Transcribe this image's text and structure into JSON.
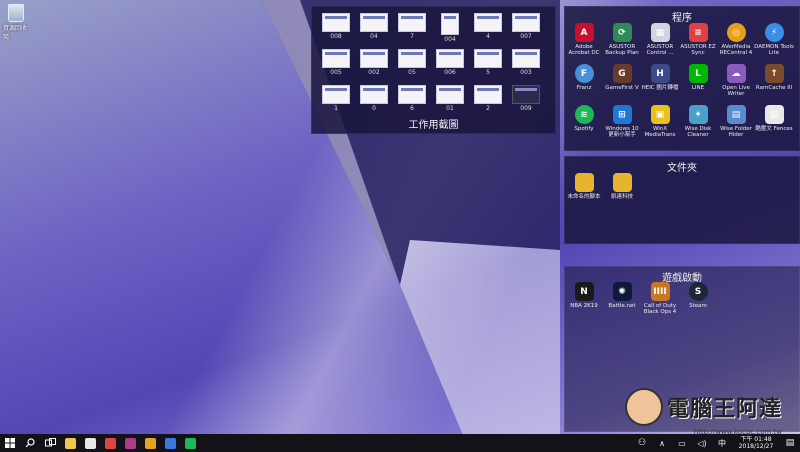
{
  "desktop": {
    "recycle_bin_label": "資源回收筒"
  },
  "fence_screenshots": {
    "title": "工作用截圖",
    "items": [
      "008",
      "04",
      "7",
      "004",
      "4",
      "007",
      "005",
      "002",
      "05",
      "006",
      "5",
      "003",
      "1",
      "0",
      "6",
      "01",
      "2",
      "009"
    ]
  },
  "fence_programs": {
    "title": "程序",
    "items": [
      {
        "label": "Adobe Acrobat DC",
        "icon": "acrobat-icon",
        "color": "#c8102e",
        "glyph": "A"
      },
      {
        "label": "ASUSTOR Backup Plan",
        "icon": "backup-icon",
        "color": "#2e8b57",
        "glyph": "⟳"
      },
      {
        "label": "ASUSTOR Control ...",
        "icon": "control-icon",
        "color": "#d0d4dc",
        "glyph": "▦"
      },
      {
        "label": "ASUSTOR EZ Sync",
        "icon": "ezsync-icon",
        "color": "#e04040",
        "glyph": "≡"
      },
      {
        "label": "AVerMedia RECentral 4",
        "icon": "recentral-icon",
        "color": "#e6a11a",
        "glyph": "◎"
      },
      {
        "label": "DAEMON Tools Lite",
        "icon": "daemon-icon",
        "color": "#3a8ee8",
        "glyph": "⚡"
      },
      {
        "label": "Franz",
        "icon": "franz-icon",
        "color": "#4a90d9",
        "glyph": "F"
      },
      {
        "label": "GameFirst V",
        "icon": "gamefirst-icon",
        "color": "#6a3a2a",
        "glyph": "G"
      },
      {
        "label": "HEIC 圖片轉檔",
        "icon": "heic-icon",
        "color": "#3a4a8a",
        "glyph": "H"
      },
      {
        "label": "LINE",
        "icon": "line-icon",
        "color": "#00b900",
        "glyph": "L"
      },
      {
        "label": "Open Live Writer",
        "icon": "livewriter-icon",
        "color": "#8a5ac0",
        "glyph": "☁"
      },
      {
        "label": "RamCache III",
        "icon": "ramcache-icon",
        "color": "#7a4a2a",
        "glyph": "↑"
      },
      {
        "label": "Spotify",
        "icon": "spotify-icon",
        "color": "#1db954",
        "glyph": "≋"
      },
      {
        "label": "Windows 10 更新小幫手",
        "icon": "windows-icon",
        "color": "#1e78d4",
        "glyph": "⊞"
      },
      {
        "label": "WinX MediaTrans",
        "icon": "mediatrans-icon",
        "color": "#e8c020",
        "glyph": "▣"
      },
      {
        "label": "Wise Disk Cleaner",
        "icon": "diskcleaner-icon",
        "color": "#4aa0c8",
        "glyph": "✦"
      },
      {
        "label": "Wise Folder Hider",
        "icon": "folderhider-icon",
        "color": "#5a8ad0",
        "glyph": "▤"
      },
      {
        "label": "酷壓文 Fences",
        "icon": "fences-icon",
        "color": "#e8e8e8",
        "glyph": "▥"
      }
    ]
  },
  "fence_folders": {
    "title": "文件夾",
    "items": [
      {
        "label": "未命名的腳本",
        "icon": "folder-icon"
      },
      {
        "label": "凱達科技",
        "icon": "folder-icon"
      }
    ]
  },
  "fence_games": {
    "title": "遊戲啟動",
    "items": [
      {
        "label": "NBA 2K19",
        "icon": "nba2k-icon",
        "color": "#1a1a1a",
        "glyph": "N"
      },
      {
        "label": "Battle.net",
        "icon": "battlenet-icon",
        "color": "#0d1a3a",
        "glyph": "✺"
      },
      {
        "label": "Call of Duty Black Ops 4",
        "icon": "cod-icon",
        "color": "#c87820",
        "glyph": "IIII"
      },
      {
        "label": "Steam",
        "icon": "steam-icon",
        "color": "#1b2838",
        "glyph": "S"
      }
    ]
  },
  "taskbar": {
    "pinned": [
      {
        "name": "file-explorer-icon",
        "color": "#f2c84b"
      },
      {
        "name": "store-icon",
        "color": "#e8e8e8"
      },
      {
        "name": "paint-icon",
        "color": "#d44"
      },
      {
        "name": "speedometer-icon",
        "color": "#b03a8a"
      },
      {
        "name": "chrome-icon",
        "color": "#e8a020"
      },
      {
        "name": "browser-icon",
        "color": "#3a7ae0"
      },
      {
        "name": "spotify-icon",
        "color": "#1db954"
      }
    ],
    "clock_time": "下午 01:48",
    "clock_date": "2018/12/27"
  },
  "watermark": {
    "text": "電腦王阿達",
    "url": "http://www.kocpc.com.tw"
  }
}
